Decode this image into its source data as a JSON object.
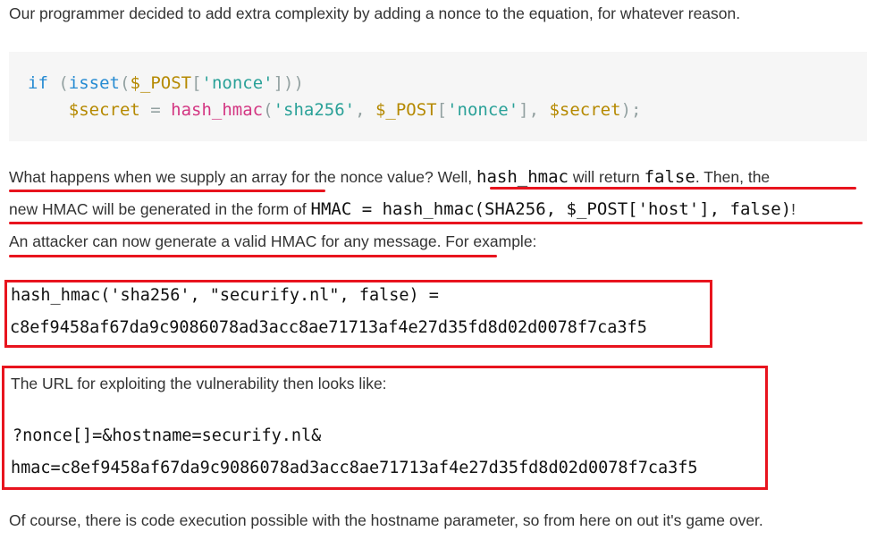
{
  "intro": "Our programmer decided to add extra complexity by adding a nonce to the equation, for whatever reason.",
  "code": {
    "line1": {
      "kw": "if",
      "p1": " (",
      "fn": "isset",
      "p2": "(",
      "var": "$_POST",
      "p3": "[",
      "str": "'nonce'",
      "p4": "]))"
    },
    "line2": {
      "indent": "    ",
      "var1": "$secret",
      "eq": " = ",
      "fn": "hash_hmac",
      "p1": "(",
      "str1": "'sha256'",
      "p2": ", ",
      "var2": "$_POST",
      "p3": "[",
      "str2": "'nonce'",
      "p4": "], ",
      "var3": "$secret",
      "p5": ");"
    }
  },
  "para2": {
    "t1": "What happens when we supply an array for the nonce value? Well, ",
    "c1": "hash_hmac",
    "t2": " will return ",
    "c2": "false",
    "t3": ". Then, the",
    "t4": "new HMAC will be generated in the form of ",
    "c3": "HMAC = hash_hmac(SHA256, $_POST['host'], false)",
    "t5": "!",
    "t6": "An attacker can now generate a valid HMAC for any message.",
    "t7": " For example:"
  },
  "box1": {
    "line1": "hash_hmac('sha256', \"securify.nl\", false) =",
    "line2": "c8ef9458af67da9c9086078ad3acc8ae71713af4e27d35fd8d02d0078f7ca3f5"
  },
  "box2": {
    "heading": "The URL for exploiting the vulnerability then looks like:",
    "url1": "?nonce[]=&hostname=securify.nl&",
    "url2": "hmac=c8ef9458af67da9c9086078ad3acc8ae71713af4e27d35fd8d02d0078f7ca3f5"
  },
  "outro": "Of course, there is code execution possible with the hostname parameter, so from here on out it's game over.",
  "colors": {
    "annotation_red": "#e8141e",
    "code_bg": "#f6f6f6"
  }
}
